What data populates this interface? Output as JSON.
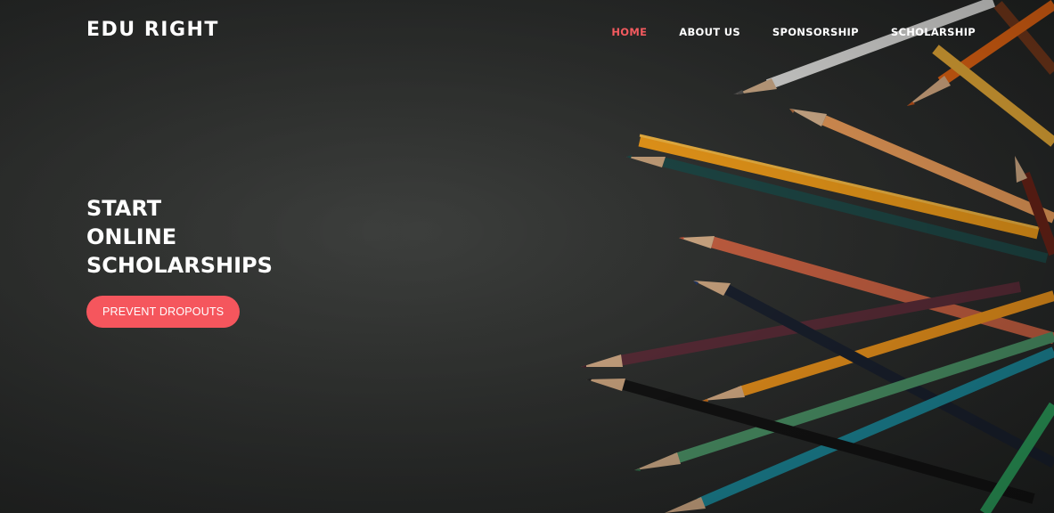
{
  "brand": {
    "name": "EDU RIGHT"
  },
  "nav": {
    "items": [
      {
        "label": "HOME",
        "active": true
      },
      {
        "label": "ABOUT US",
        "active": false
      },
      {
        "label": "SPONSORSHIP",
        "active": false
      },
      {
        "label": "SCHOLARSHIP",
        "active": false
      }
    ]
  },
  "hero": {
    "title_lines": [
      "START",
      "ONLINE",
      "SCHOLARSHIPS"
    ],
    "cta_label": "PREVENT DROPOUTS"
  },
  "colors": {
    "accent": "#f5565d",
    "background": "#2e302f",
    "text": "#ffffff"
  },
  "icons": {
    "background_image": "colored-pencils-image"
  }
}
